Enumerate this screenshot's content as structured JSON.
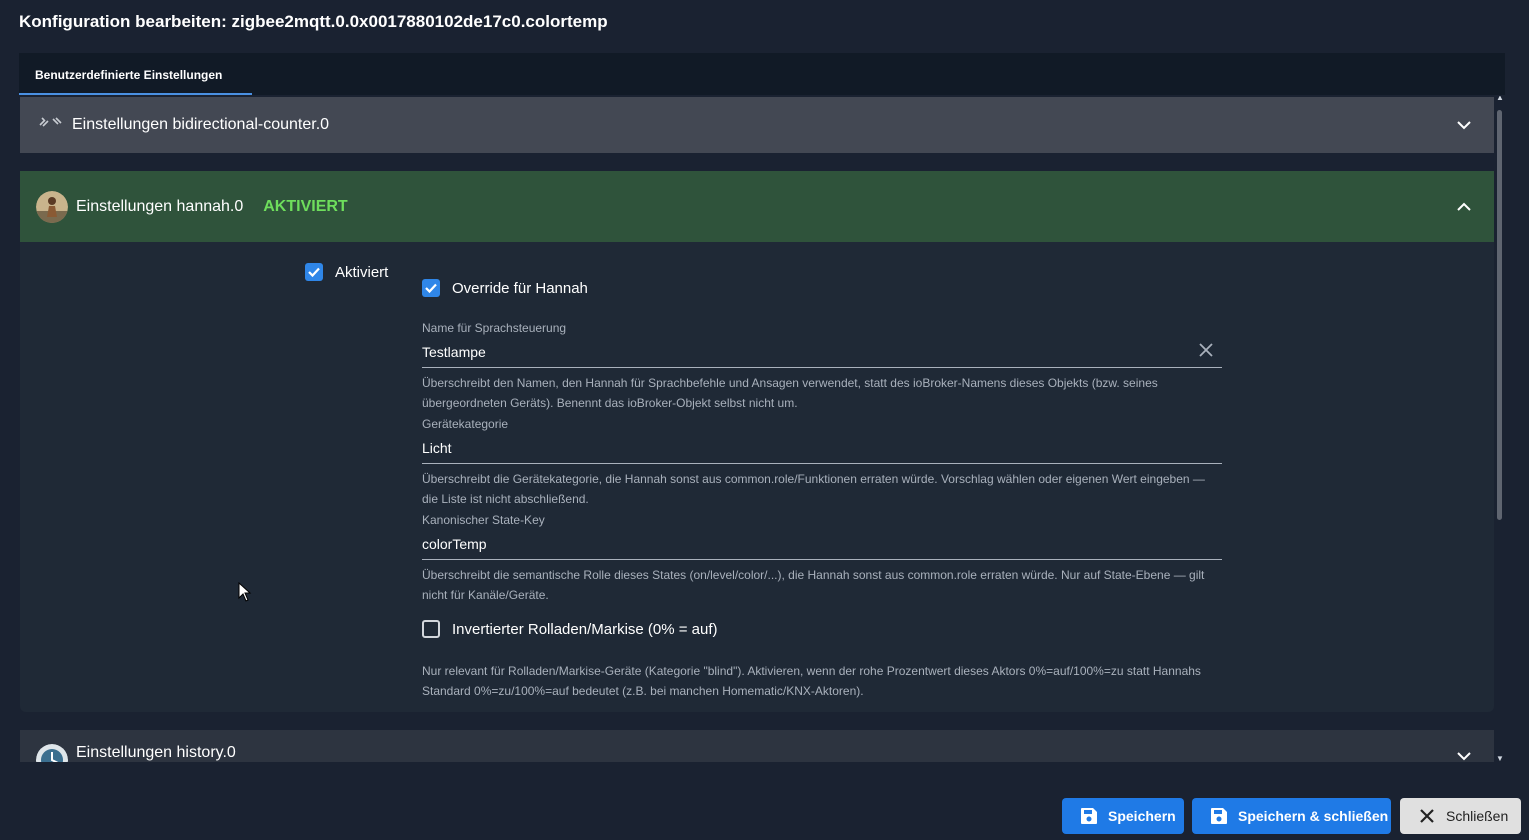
{
  "dialog": {
    "title": "Konfiguration bearbeiten: zigbee2mqtt.0.0x0017880102de17c0.colortemp"
  },
  "tabs": [
    {
      "label": "Benutzerdefinierte Einstellungen"
    }
  ],
  "panels": {
    "bidirectional": {
      "label": "Einstellungen bidirectional-counter.0",
      "expanded": false
    },
    "hannah": {
      "label": "Einstellungen hannah.0",
      "status": "AKTIVIERT",
      "expanded": true,
      "enabled_label": "Aktiviert",
      "override_label": "Override für Hannah",
      "name_field": {
        "label": "Name für Sprachsteuerung",
        "value": "Testlampe",
        "help": "Überschreibt den Namen, den Hannah für Sprachbefehle und Ansagen verwendet, statt des ioBroker-Namens dieses Objekts (bzw. seines übergeordneten Geräts). Benennt das ioBroker-Objekt selbst nicht um."
      },
      "category_field": {
        "label": "Gerätekategorie",
        "value": "Licht",
        "help": "Überschreibt die Gerätekategorie, die Hannah sonst aus common.role/Funktionen erraten würde. Vorschlag wählen oder eigenen Wert eingeben — die Liste ist nicht abschließend."
      },
      "statekey_field": {
        "label": "Kanonischer State-Key",
        "value": "colorTemp",
        "help": "Überschreibt die semantische Rolle dieses States (on/level/color/...), die Hannah sonst aus common.role erraten würde. Nur auf State-Ebene — gilt nicht für Kanäle/Geräte."
      },
      "inverted_label": "Invertierter Rolladen/Markise (0% = auf)",
      "inverted_help": "Nur relevant für Rolladen/Markise-Geräte (Kategorie \"blind\"). Aktivieren, wenn der rohe Prozentwert dieses Aktors 0%=auf/100%=zu statt Hannahs Standard 0%=zu/100%=auf bedeutet (z.B. bei manchen Homematic/KNX-Aktoren)."
    },
    "history": {
      "label": "Einstellungen history.0",
      "expanded": false
    }
  },
  "footer": {
    "save": "Speichern",
    "save_close": "Speichern & schließen",
    "close": "Schließen"
  },
  "colors": {
    "background": "#1a2231",
    "accent": "#1f7ae6",
    "active_green": "#6ede5c",
    "active_panel": "#2f533b"
  }
}
